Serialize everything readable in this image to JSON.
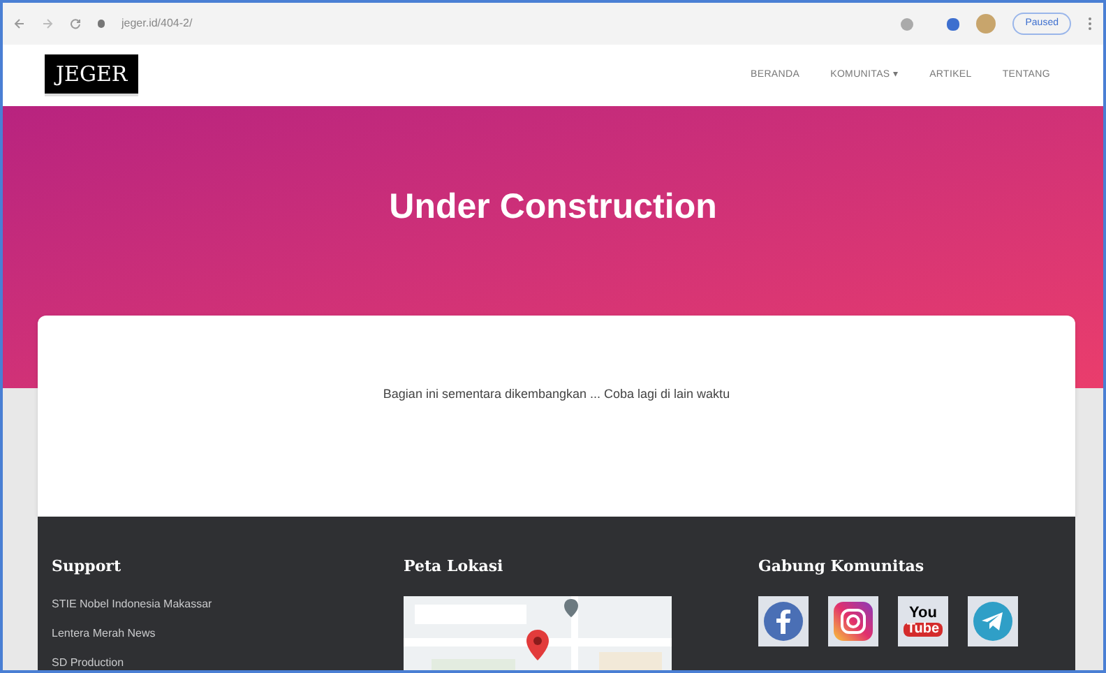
{
  "browser": {
    "url": "jeger.id/404-2/",
    "profile": "Paused"
  },
  "header": {
    "logo": "JEGER",
    "nav": [
      {
        "label": "BERANDA"
      },
      {
        "label": "KOMUNITAS ▾"
      },
      {
        "label": "ARTIKEL"
      },
      {
        "label": "TENTANG"
      }
    ]
  },
  "hero": {
    "title": "Under Construction"
  },
  "card": {
    "message": "Bagian ini sementara dikembangkan ... Coba lagi di lain waktu"
  },
  "footer": {
    "columns": [
      {
        "kind": "links",
        "title": "Support",
        "links": [
          "STIE Nobel Indonesia Makassar",
          "Lentera Merah News",
          "SD Production"
        ]
      },
      {
        "kind": "map",
        "title": "Peta Lokasi"
      },
      {
        "kind": "social",
        "title": "Gabung Komunitas",
        "icons": [
          {
            "kind": "facebook"
          },
          {
            "kind": "instagram"
          },
          {
            "kind": "youtube",
            "text": [
              "You",
              "Tube"
            ]
          },
          {
            "kind": "telegram"
          }
        ]
      }
    ]
  }
}
